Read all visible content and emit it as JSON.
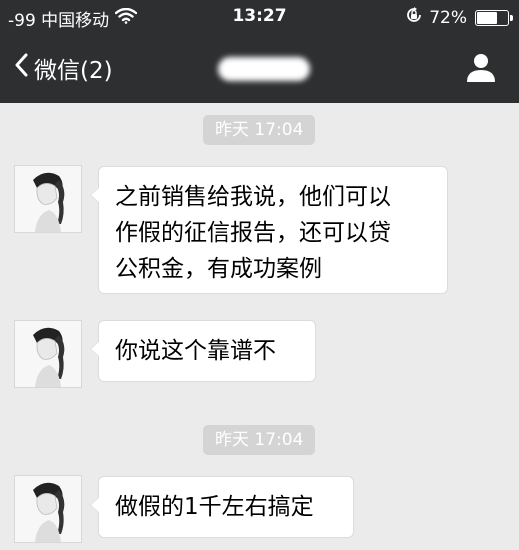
{
  "status_bar": {
    "carrier": "-99 中国移动",
    "time": "13:27",
    "battery": "72%",
    "battery_level": 0.72
  },
  "nav": {
    "back_label": "微信(2)"
  },
  "messages": [
    {
      "timestamp": "昨天 17:04"
    },
    {
      "text_lines": [
        "之前销售给我说，他们可以",
        "作假的征信报告，还可以贷",
        "公积金，有成功案例"
      ]
    },
    {
      "text": "你说这个靠谱不"
    },
    {
      "timestamp": "昨天 17:04"
    },
    {
      "text": "做假的1千左右搞定"
    }
  ]
}
